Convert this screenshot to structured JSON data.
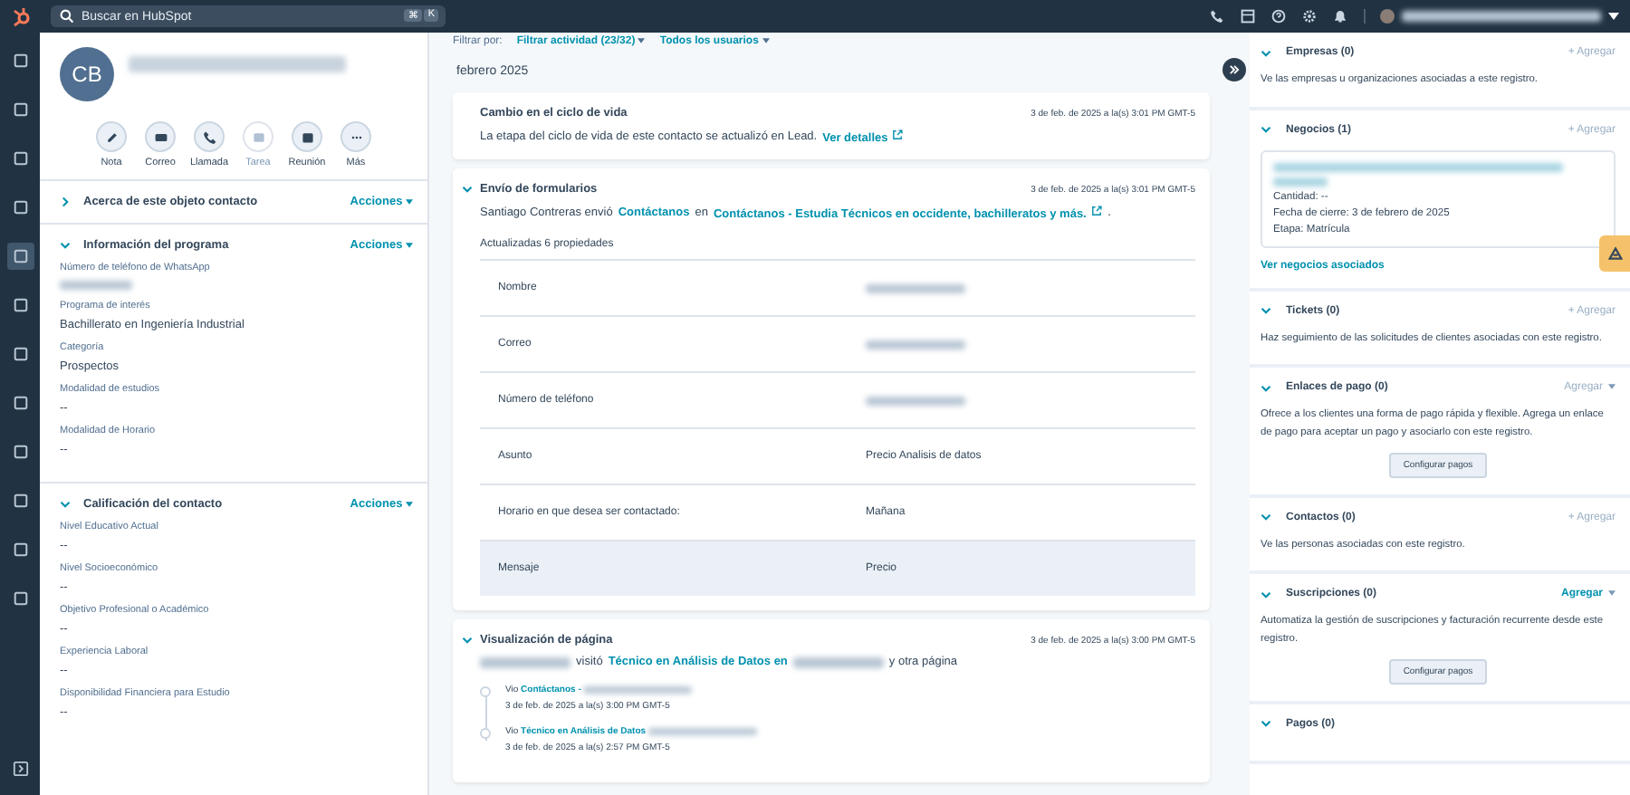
{
  "topbar": {
    "search": {
      "placeholder": "Buscar en HubSpot"
    },
    "shortcut": [
      "⌘",
      "K"
    ]
  },
  "profile": {
    "initials": "CB",
    "actions": [
      {
        "label": "Nota",
        "kind": "note",
        "disabled": false
      },
      {
        "label": "Correo",
        "kind": "mail",
        "disabled": false
      },
      {
        "label": "Llamada",
        "kind": "phone",
        "disabled": false
      },
      {
        "label": "Tarea",
        "kind": "task",
        "disabled": true
      },
      {
        "label": "Reunión",
        "kind": "calendar",
        "disabled": false
      },
      {
        "label": "Más",
        "kind": "more",
        "disabled": false
      }
    ]
  },
  "left_sections": [
    {
      "title": "Acerca de este objeto contacto",
      "action": "Acciones",
      "expanded": false
    },
    {
      "title": "Información del programa",
      "action": "Acciones",
      "expanded": true,
      "fields": [
        {
          "label": "Número de teléfono de WhatsApp",
          "redacted": true
        },
        {
          "label": "Programa de interés",
          "value": "Bachillerato en Ingeniería Industrial"
        },
        {
          "label": "Categoría",
          "value": "Prospectos"
        },
        {
          "label": "Modalidad de estudios",
          "value": "--"
        },
        {
          "label": "Modalidad de Horario",
          "value": "--"
        }
      ]
    },
    {
      "title": "Calificación del contacto",
      "action": "Acciones",
      "expanded": true,
      "fields": [
        {
          "label": "Nivel Educativo Actual",
          "value": "--"
        },
        {
          "label": "Nivel Socioeconómico",
          "value": "--"
        },
        {
          "label": "Objetivo Profesional o Académico",
          "value": "--"
        },
        {
          "label": "Experiencia Laboral",
          "value": "--"
        },
        {
          "label": "Disponibilidad Financiera para Estudio",
          "value": "--"
        }
      ]
    }
  ],
  "filter": {
    "label": "Filtrar por:",
    "options": [
      "Filtrar actividad (23/32)",
      "Todos los usuarios"
    ]
  },
  "month": "febrero 2025",
  "activities": [
    {
      "kind": "lifecycle",
      "title": "Cambio en el ciclo de vida",
      "time": "3 de feb. de 2025 a la(s) 3:01 PM GMT-5",
      "segments": [
        {
          "kind": "plain",
          "text": "La etapa del ciclo de vida de este contacto se actualizó en Lead."
        },
        {
          "kind": "external",
          "text": "Ver detalles"
        }
      ]
    },
    {
      "kind": "form",
      "title": "Envío de formularios",
      "time": "3 de feb. de 2025 a la(s) 3:01 PM GMT-5",
      "segments": [
        {
          "kind": "plain",
          "text": "Santiago Contreras envió"
        },
        {
          "kind": "link",
          "text": "Contáctanos"
        },
        {
          "kind": "plain",
          "text": "en"
        },
        {
          "kind": "external",
          "text": "Contáctanos - Estudia Técnicos en occidente, bachilleratos y más."
        },
        {
          "kind": "plain",
          "text": "."
        }
      ],
      "summary": "Actualizadas 6 propiedades",
      "properties": [
        {
          "name": "Nombre",
          "redacted": true,
          "highlighted": false
        },
        {
          "name": "Correo",
          "redacted": true,
          "highlighted": false
        },
        {
          "name": "Número de teléfono",
          "redacted": true,
          "highlighted": false
        },
        {
          "name": "Asunto",
          "value": "Precio Analisis de datos",
          "highlighted": false
        },
        {
          "name": "Horario en que desea ser contactado:",
          "value": "Mañana",
          "highlighted": false
        },
        {
          "name": "Mensaje",
          "value": "Precio",
          "highlighted": true
        }
      ]
    },
    {
      "kind": "pageview",
      "title": "Visualización de página",
      "time": "3 de feb. de 2025 a la(s) 3:00 PM GMT-5",
      "segments": [
        {
          "kind": "redacted"
        },
        {
          "kind": "plain",
          "text": "visitó"
        },
        {
          "kind": "link",
          "text": "Técnico en Análisis de Datos en"
        },
        {
          "kind": "redacted"
        },
        {
          "kind": "plain",
          "text": "y otra página"
        }
      ],
      "visits": [
        {
          "prefix": "Vio",
          "link": "Contáctanos -",
          "time": "3 de feb. de 2025 a la(s) 3:00 PM GMT-5"
        },
        {
          "prefix": "Vio",
          "link": "Técnico en Análisis de Datos",
          "time": "3 de feb. de 2025 a la(s) 2:57 PM GMT-5"
        }
      ]
    }
  ],
  "right_sections": [
    {
      "title": "Empresas (0)",
      "add": {
        "label": "+ Agregar",
        "kind": "plus",
        "disabled": true
      },
      "text": "Ve las empresas u organizaciones asociadas a este registro."
    },
    {
      "title": "Negocios (1)",
      "add": {
        "label": "+ Agregar",
        "kind": "plus",
        "disabled": true
      },
      "deal": {
        "lines": [
          "Cantidad: --",
          "Fecha de cierre: 3 de febrero de 2025",
          "Etapa: Matrícula"
        ]
      },
      "link": "Ver negocios asociados"
    },
    {
      "title": "Tickets (0)",
      "add": {
        "label": "+ Agregar",
        "kind": "plus",
        "disabled": true
      },
      "text": "Haz seguimiento de las solicitudes de clientes asociadas con este registro."
    },
    {
      "title": "Enlaces de pago (0)",
      "add": {
        "label": "Agregar",
        "kind": "dropdown",
        "disabled": true
      },
      "text": "Ofrece a los clientes una forma de pago rápida y flexible. Agrega un enlace de pago para aceptar un pago y asociarlo con este registro.",
      "button": "Configurar pagos"
    },
    {
      "title": "Contactos (0)",
      "add": {
        "label": "+ Agregar",
        "kind": "plus",
        "disabled": true
      },
      "text": "Ve las personas asociadas con este registro."
    },
    {
      "title": "Suscripciones (0)",
      "add": {
        "label": "Agregar",
        "kind": "dropdown",
        "disabled": false
      },
      "text": "Automatiza la gestión de suscripciones y facturación recurrente desde este registro.",
      "button": "Configurar pagos"
    },
    {
      "title": "Pagos (0)"
    }
  ]
}
